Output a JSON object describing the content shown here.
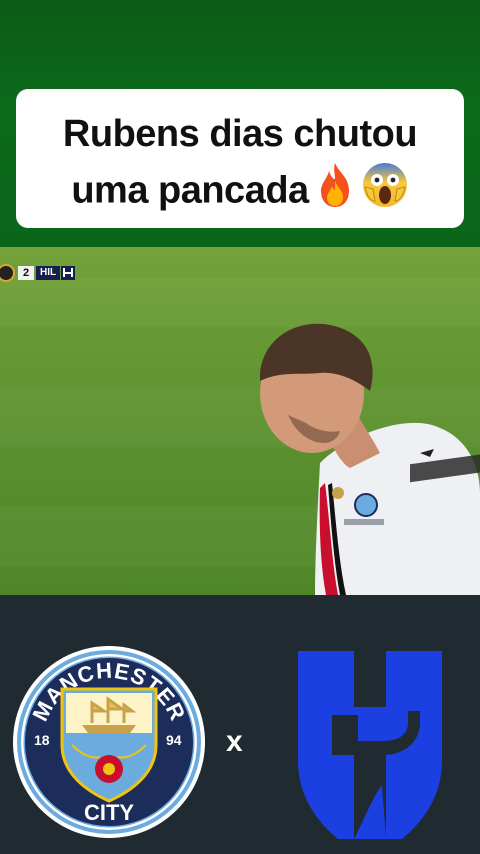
{
  "caption": {
    "line1": "Rubens dias chutou",
    "line2": "uma pancada",
    "emoji1": "🔥",
    "emoji2": "😱"
  },
  "scoreboard": {
    "score": "2",
    "team_abbrev": "HIL"
  },
  "matchup": {
    "home_crest": "manchester-city-crest",
    "home_crest_text_top": "MANCHESTER",
    "home_crest_text_bottom": "CITY",
    "home_crest_year_left": "18",
    "home_crest_year_right": "94",
    "separator": "x",
    "away_crest": "al-hilal-crest"
  },
  "colors": {
    "top_bg": "#0b6a1a",
    "bottom_bg": "#1f2b31",
    "city_blue": "#6cabdd",
    "hilal_blue": "#1b3fe0"
  }
}
